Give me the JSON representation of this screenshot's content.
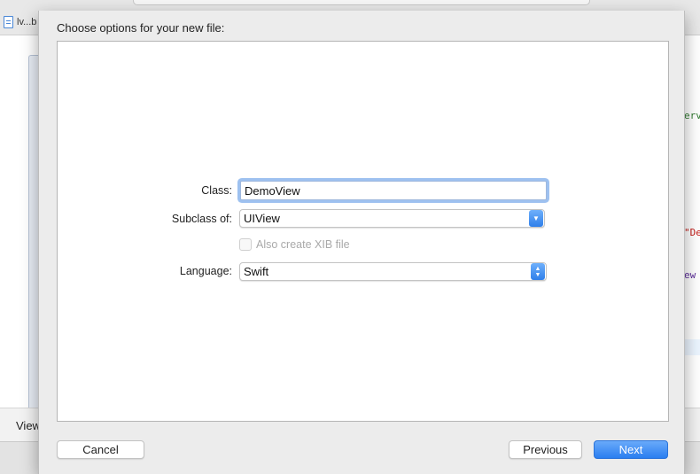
{
  "background": {
    "file_tab": "lv...b",
    "code_snippets": [
      "erv",
      "\"De",
      "ew"
    ],
    "bottom_label": "View"
  },
  "sheet": {
    "title": "Choose options for your new file:",
    "fields": {
      "class_label": "Class:",
      "class_value": "DemoView",
      "subclass_label": "Subclass of:",
      "subclass_value": "UIView",
      "xib_checkbox_label": "Also create XIB file",
      "xib_checked": false,
      "language_label": "Language:",
      "language_value": "Swift"
    },
    "buttons": {
      "cancel": "Cancel",
      "previous": "Previous",
      "next": "Next"
    }
  },
  "colors": {
    "accent": "#2a7ef0",
    "focus_ring": "#9ec1f0",
    "disabled_text": "#a9a9a9"
  },
  "icons": [
    "file-icon",
    "popup-arrows-icon",
    "chevron-down-icon"
  ]
}
